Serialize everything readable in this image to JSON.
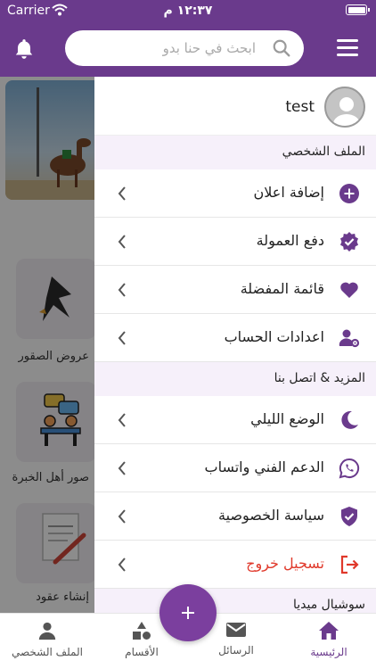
{
  "status_bar": {
    "carrier": "Carrier",
    "time": "١٢:٣٧ م"
  },
  "header": {
    "search_placeholder": "ابحث في حنا بدو"
  },
  "background": {
    "categories": [
      "عروض الصقور",
      "صور أهل الخبرة",
      "إنشاء عقود"
    ]
  },
  "drawer": {
    "username": "test",
    "sections": [
      {
        "title": "الملف الشخصي",
        "items": [
          {
            "label": "إضافة اعلان",
            "icon": "plus-circle-icon"
          },
          {
            "label": "دفع العمولة",
            "icon": "verified-badge-icon"
          },
          {
            "label": "قائمة المفضلة",
            "icon": "heart-icon"
          },
          {
            "label": "اعدادات الحساب",
            "icon": "user-settings-icon"
          }
        ]
      },
      {
        "title": "المزيد & اتصل بنا",
        "items": [
          {
            "label": "الوضع الليلي",
            "icon": "moon-icon"
          },
          {
            "label": "الدعم الفني واتساب",
            "icon": "whatsapp-icon"
          },
          {
            "label": "سياسة الخصوصية",
            "icon": "shield-check-icon"
          },
          {
            "label": "تسجيل خروج",
            "icon": "logout-icon"
          }
        ]
      },
      {
        "title": "سوشيال ميديا",
        "items": []
      }
    ]
  },
  "bottom_nav": {
    "tabs": [
      {
        "label": "الملف الشخصي",
        "icon": "person-icon"
      },
      {
        "label": "الأقسام",
        "icon": "shapes-icon"
      },
      {
        "label": "الرسائل",
        "icon": "mail-icon"
      },
      {
        "label": "الرئيسية",
        "icon": "home-icon"
      }
    ]
  },
  "colors": {
    "primary": "#6a3a8c",
    "logout": "#e0392b",
    "section_bg": "#f6f0fa"
  }
}
